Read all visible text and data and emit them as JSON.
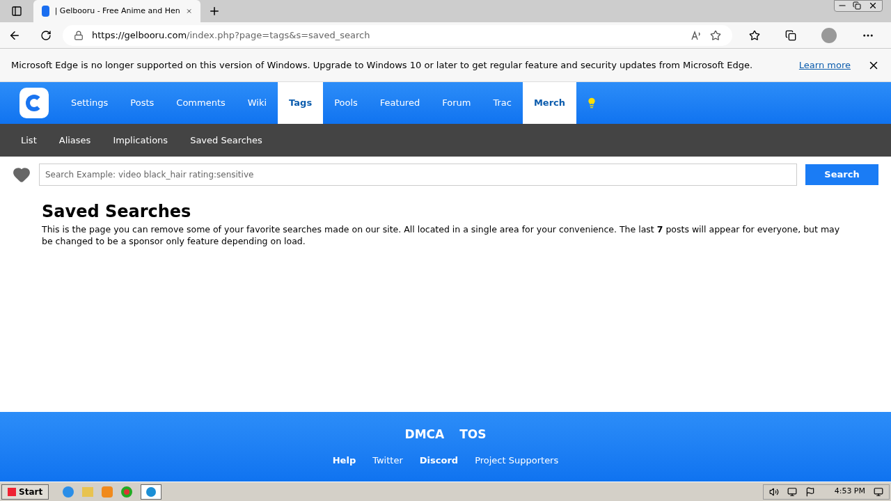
{
  "browser": {
    "tab_title": "| Gelbooru - Free Anime and Hen",
    "url_host": "https://gelbooru.com",
    "url_path": "/index.php?page=tags&s=saved_search"
  },
  "infobar": {
    "message": "Microsoft Edge is no longer supported on this version of Windows. Upgrade to Windows 10 or later to get regular feature and security updates from Microsoft Edge.",
    "link": "Learn more"
  },
  "nav": [
    {
      "label": "Settings",
      "highlighted": false
    },
    {
      "label": "Posts",
      "highlighted": false
    },
    {
      "label": "Comments",
      "highlighted": false
    },
    {
      "label": "Wiki",
      "highlighted": false
    },
    {
      "label": "Tags",
      "highlighted": true
    },
    {
      "label": "Pools",
      "highlighted": false
    },
    {
      "label": "Featured",
      "highlighted": false
    },
    {
      "label": "Forum",
      "highlighted": false
    },
    {
      "label": "Trac",
      "highlighted": false
    },
    {
      "label": "Merch",
      "highlighted": true
    }
  ],
  "subnav": [
    "List",
    "Aliases",
    "Implications",
    "Saved Searches"
  ],
  "search": {
    "placeholder": "Search Example: video black_hair rating:sensitive",
    "button": "Search"
  },
  "content": {
    "heading": "Saved Searches",
    "text": "This is the page you can remove some of your favorite searches made on our site. All located in a single area for your convenience. The last **7** posts will appear for everyone, but may be changed to be a sponsor only feature depending on load."
  },
  "footer": {
    "top_links": [
      "DMCA",
      "TOS"
    ],
    "links": [
      {
        "label": "Help",
        "bold": true
      },
      {
        "label": "Twitter",
        "bold": false
      },
      {
        "label": "Discord",
        "bold": true
      },
      {
        "label": "Project Supporters",
        "bold": false
      }
    ]
  },
  "taskbar": {
    "start": "Start",
    "clock": "4:53 PM"
  }
}
